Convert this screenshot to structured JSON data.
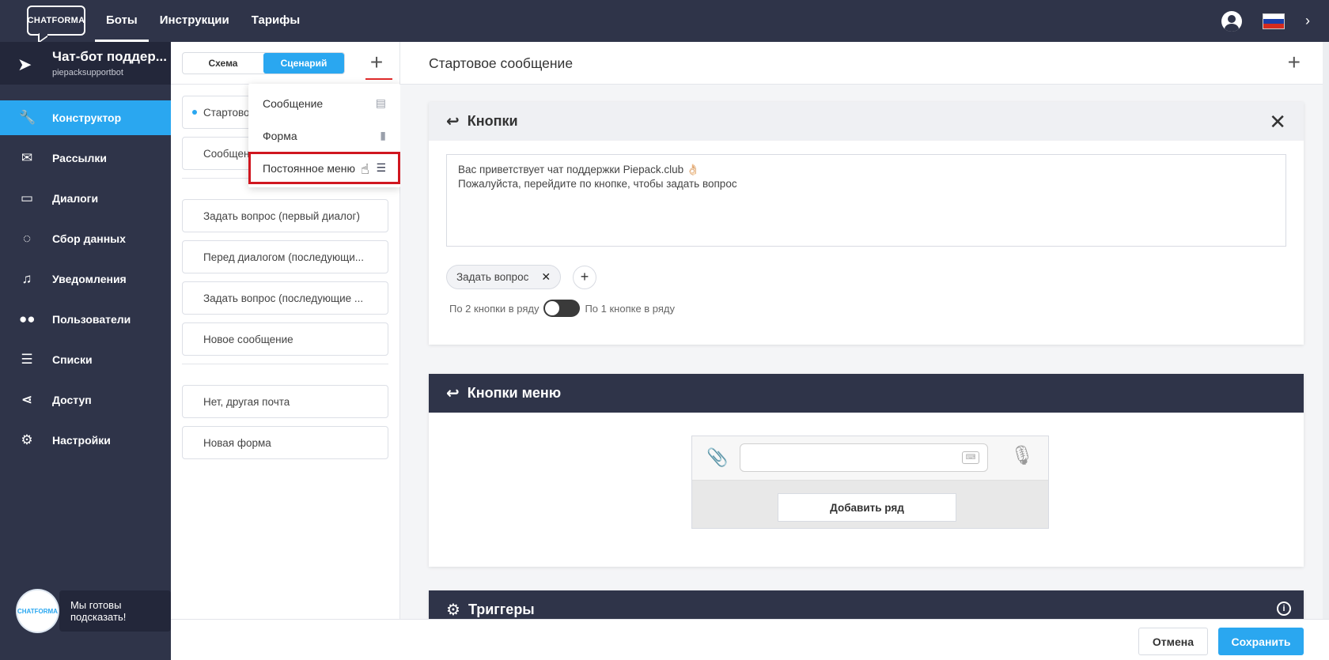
{
  "topbar": {
    "logo": "CHATFORMA",
    "nav": [
      "Боты",
      "Инструкции",
      "Тарифы"
    ],
    "flag_colors": [
      "#ffffff",
      "#1c3fa8",
      "#d52b1e"
    ]
  },
  "sidebar": {
    "bot_name": "Чат-бот поддер...",
    "bot_username": "piepacksupportbot",
    "items": [
      {
        "label": "Конструктор",
        "icon": "wrench-icon"
      },
      {
        "label": "Рассылки",
        "icon": "envelope-icon"
      },
      {
        "label": "Диалоги",
        "icon": "chat-icon"
      },
      {
        "label": "Сбор данных",
        "icon": "ring-icon"
      },
      {
        "label": "Уведомления",
        "icon": "bell-icon"
      },
      {
        "label": "Пользователи",
        "icon": "users-icon"
      },
      {
        "label": "Списки",
        "icon": "list-icon"
      },
      {
        "label": "Доступ",
        "icon": "share-icon"
      },
      {
        "label": "Настройки",
        "icon": "gear-icon"
      }
    ],
    "help_avatar": "CHATFORMA",
    "help_text": "Мы готовы подсказать!"
  },
  "scenario": {
    "tabs": [
      "Схема",
      "Сценарий"
    ],
    "steps_group1": [
      "Стартово",
      "Сообщен"
    ],
    "steps_group2": [
      "Задать вопрос (первый диалог)",
      "Перед диалогом (последующи...",
      "Задать вопрос (последующие ...",
      "Новое сообщение"
    ],
    "steps_group3": [
      "Нет, другая почта",
      "Новая форма"
    ]
  },
  "dropdown": {
    "items": [
      {
        "label": "Сообщение",
        "icon": "message-icon"
      },
      {
        "label": "Форма",
        "icon": "bar-chart-icon"
      },
      {
        "label": "Постоянное меню",
        "icon": "list-icon"
      }
    ]
  },
  "main": {
    "title": "Стартовое сообщение",
    "buttons_card": {
      "title": "Кнопки",
      "text_line1": "Вас приветствует чат поддержки Piepack.club 👌🏻",
      "text_line2": "Пожалуйста, перейдите по кнопке, чтобы задать вопрос",
      "chip": "Задать вопрос",
      "toggle_left": "По 2 кнопки в ряду",
      "toggle_right": "По 1 кнопке в ряду"
    },
    "menu_card": {
      "title": "Кнопки меню",
      "add_row": "Добавить ряд"
    },
    "triggers_card": {
      "title": "Триггеры"
    }
  },
  "footer": {
    "cancel": "Отмена",
    "save": "Сохранить"
  }
}
